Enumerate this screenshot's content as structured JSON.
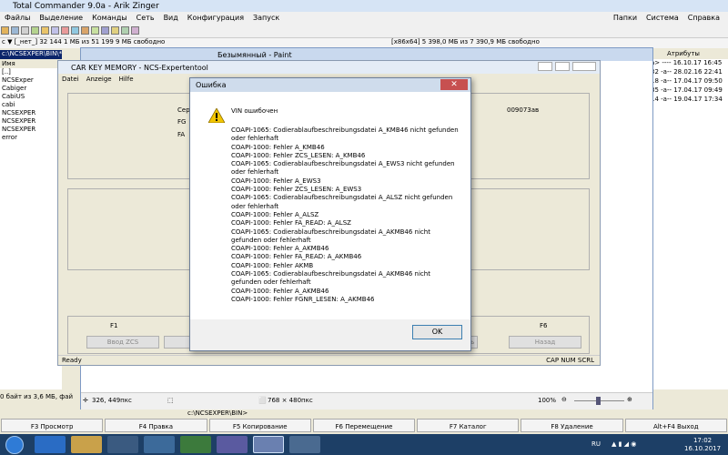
{
  "tc": {
    "title": "Total Commander 9.0a - Arik Zinger",
    "menu": [
      "Файлы",
      "Выделение",
      "Команды",
      "Сеть",
      "Вид",
      "Конфигурация",
      "Запуск"
    ],
    "menu_right": [
      "Папки",
      "Система",
      "Справка"
    ],
    "drive_left": "c ▼  [_нет_]  32 144 1 МБ из 51 199 9 МБ свободно",
    "drive_right": "[x86x64]  5 398,0 МБ из 7 390,9 МБ свободно",
    "left_path": "c:\\NCSEXPER\\BIN\\*.*",
    "left_header": "Имя",
    "left_files": [
      "[..]",
      "NCSExper",
      "Cabiger",
      "CabiUS",
      "cabi",
      "NCSEXPER",
      "NCSEXPER",
      "NCSEXPER",
      "error"
    ],
    "right_header": "Атрибуты",
    "right_rows": [
      "a> ----  16.10.17 16:45",
      "32 -a--  28.02.16 22:41",
      "18 -a--  17.04.17 09:50",
      "85 -a--  17.04.17 09:49",
      "14 -a--  19.04.17 17:34"
    ],
    "status_left": "0 байт из 3,6 МБ, файлов",
    "cmd_path": "c:\\NCSEXPER\\BIN>",
    "fkeys": [
      "F3 Просмотр",
      "F4 Правка",
      "F5 Копирование",
      "F6 Перемещение",
      "F7 Каталог",
      "F8 Удаление",
      "Alt+F4 Выход"
    ]
  },
  "paint": {
    "title": "Безымянный - Paint",
    "coords": "326, 449пкс",
    "size": "768 × 480пкс",
    "zoom": "100%"
  },
  "ncs": {
    "title": "CAR KEY MEMORY - NCS-Expertentool",
    "menu": [
      "Datei",
      "Anzeige",
      "Hilfe"
    ],
    "labels": [
      "Сери",
      "FG",
      "FA"
    ],
    "value": "009073ав",
    "f1": "F1",
    "f1_btn": "Ввод ZCS",
    "f6": "F6",
    "f6_btn": "Назад",
    "mid_btn": "ать",
    "status": "Ready",
    "status_right": "CAP NUM SCRL"
  },
  "dialog": {
    "title": "Ошибка",
    "close": "✕",
    "heading": "VIN ошибочен",
    "lines": [
      "COAPI-1065: Codierablaufbeschreibungsdatei A_KMB46 nicht gefunden",
      "oder fehlerhaft",
      "COAPI-1000: Fehler  A_KMB46",
      "COAPI-1000: Fehler  ZCS_LESEN: A_KMB46",
      "COAPI-1065: Codierablaufbeschreibungsdatei A_EWS3 nicht gefunden",
      "oder fehlerhaft",
      "COAPI-1000: Fehler  A_EWS3",
      "COAPI-1000: Fehler  ZCS_LESEN: A_EWS3",
      "COAPI-1065: Codierablaufbeschreibungsdatei A_ALSZ nicht gefunden",
      "oder fehlerhaft",
      "COAPI-1000: Fehler  A_ALSZ",
      "COAPI-1000: Fehler  FA_READ: A_ALSZ",
      "COAPI-1065: Codierablaufbeschreibungsdatei A_AKMB46 nicht",
      "gefunden oder fehlerhaft",
      "COAPI-1000: Fehler  A_AKMB46",
      "COAPI-1000: Fehler  FA_READ: A_AKMB46",
      "COAPI-1000: Fehler  AKMB",
      "COAPI-1065: Codierablaufbeschreibungsdatei A_AKMB46 nicht",
      "gefunden oder fehlerhaft",
      "COAPI-1000: Fehler  A_AKMB46",
      "COAPI-1000: Fehler  FGNR_LESEN: A_AKMB46"
    ],
    "ok": "OK"
  },
  "taskbar": {
    "lang": "RU",
    "time": "17:02",
    "date": "16.10.2017"
  },
  "colors": {
    "accent": "#0a246a",
    "close": "#c75050",
    "taskbar": "#1d3f66"
  }
}
